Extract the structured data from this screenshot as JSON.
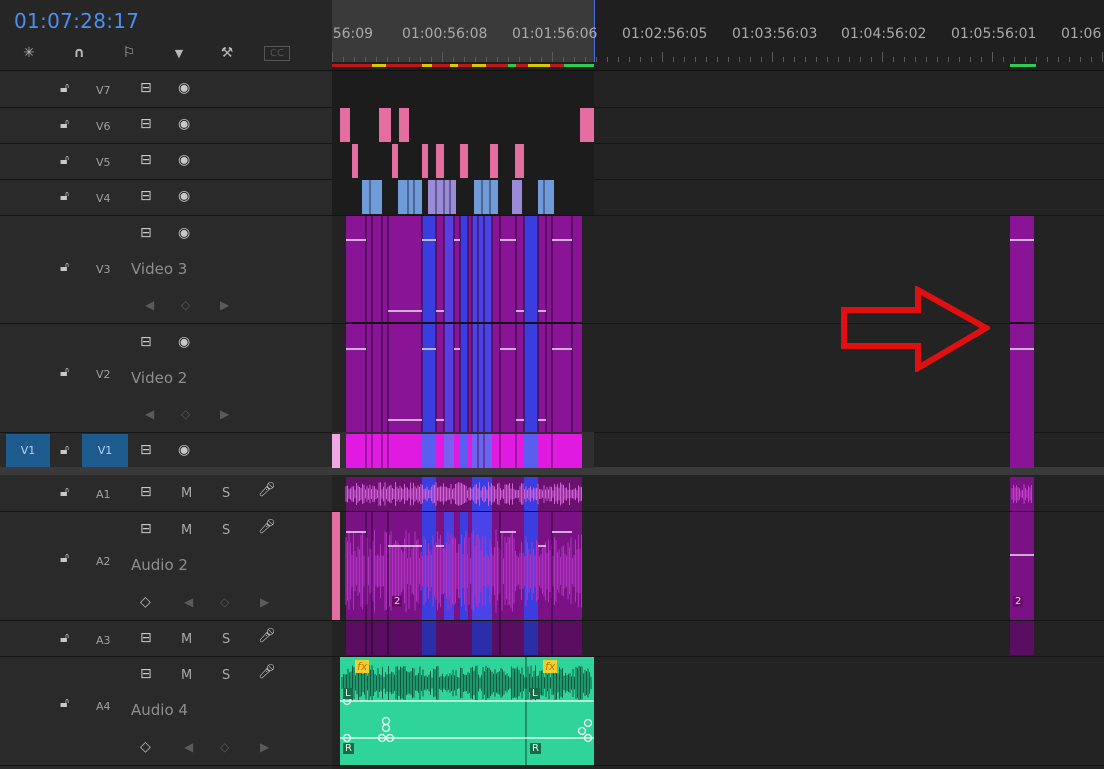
{
  "timecode": "01:07:28:17",
  "toolbar": {
    "tools": [
      {
        "name": "snap-icon",
        "glyph": "✳"
      },
      {
        "name": "magnet-icon",
        "glyph": "∩"
      },
      {
        "name": "linked-selection-icon",
        "glyph": "⚐"
      },
      {
        "name": "marker-icon",
        "glyph": "▼"
      },
      {
        "name": "wrench-icon",
        "glyph": "⚒"
      },
      {
        "name": "captions-icon",
        "glyph": "CC"
      }
    ]
  },
  "ruler": {
    "labels": [
      ":56:09",
      "01:00:56:08",
      "01:01:56:06",
      "01:02:56:05",
      "01:03:56:03",
      "01:04:56:02",
      "01:05:56:01",
      "01:06"
    ]
  },
  "tracks": {
    "video": [
      {
        "id": "V7",
        "label": ""
      },
      {
        "id": "V6",
        "label": ""
      },
      {
        "id": "V5",
        "label": ""
      },
      {
        "id": "V4",
        "label": ""
      },
      {
        "id": "V3",
        "label": "Video 3"
      },
      {
        "id": "V2",
        "label": "Video 2"
      },
      {
        "id": "V1",
        "label": ""
      }
    ],
    "audio": [
      {
        "id": "A1",
        "label": ""
      },
      {
        "id": "A2",
        "label": "Audio 2"
      },
      {
        "id": "A3",
        "label": ""
      },
      {
        "id": "A4",
        "label": "Audio 4"
      }
    ],
    "source_patch": "V1",
    "mute_label": "M",
    "solo_label": "S",
    "clip_count_badge": "2",
    "fx_label": "fx",
    "channel_left": "L",
    "channel_right": "R"
  },
  "colors": {
    "timecode": "#4b8ff0",
    "clip_magenta": "#8a1496",
    "clip_blue": "#3a3ee0",
    "clip_pink": "#e46ea0",
    "clip_lightblue": "#6f9bd8",
    "audio_green": "#2ed49a",
    "arrow_red": "#e01010"
  }
}
